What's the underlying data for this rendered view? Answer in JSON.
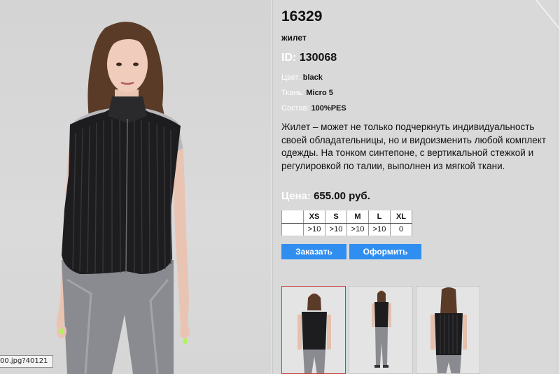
{
  "product": {
    "code": "16329",
    "type": "жилет",
    "id_label": "ID:",
    "id_value": "130068",
    "attributes": [
      {
        "label": "Цвет:",
        "value": "black"
      },
      {
        "label": "Ткань:",
        "value": "Micro 5"
      },
      {
        "label": "Состав:",
        "value": "100%PES"
      }
    ],
    "description": "Жилет – может не только подчеркнуть индивидуальность своей обладательницы, но и видоизменить любой комплект одежды. На тонком синтепоне, с вертикальной стежкой и регулировкой по талии, выполнен из мягкой ткани.",
    "price_label": "Цена:",
    "price_value": "655.00 руб."
  },
  "sizes": {
    "headers": [
      "XS",
      "S",
      "M",
      "L",
      "XL"
    ],
    "stock": [
      ">10",
      ">10",
      ">10",
      ">10",
      "0"
    ]
  },
  "actions": {
    "order_label": "Заказать",
    "checkout_label": "Оформить"
  },
  "status_tooltip": "00.jpg?40121",
  "colors": {
    "background": "#d9d9d9",
    "button": "#2f8ef0",
    "active_thumb_border": "#c43a3a",
    "label": "#ffffff"
  }
}
